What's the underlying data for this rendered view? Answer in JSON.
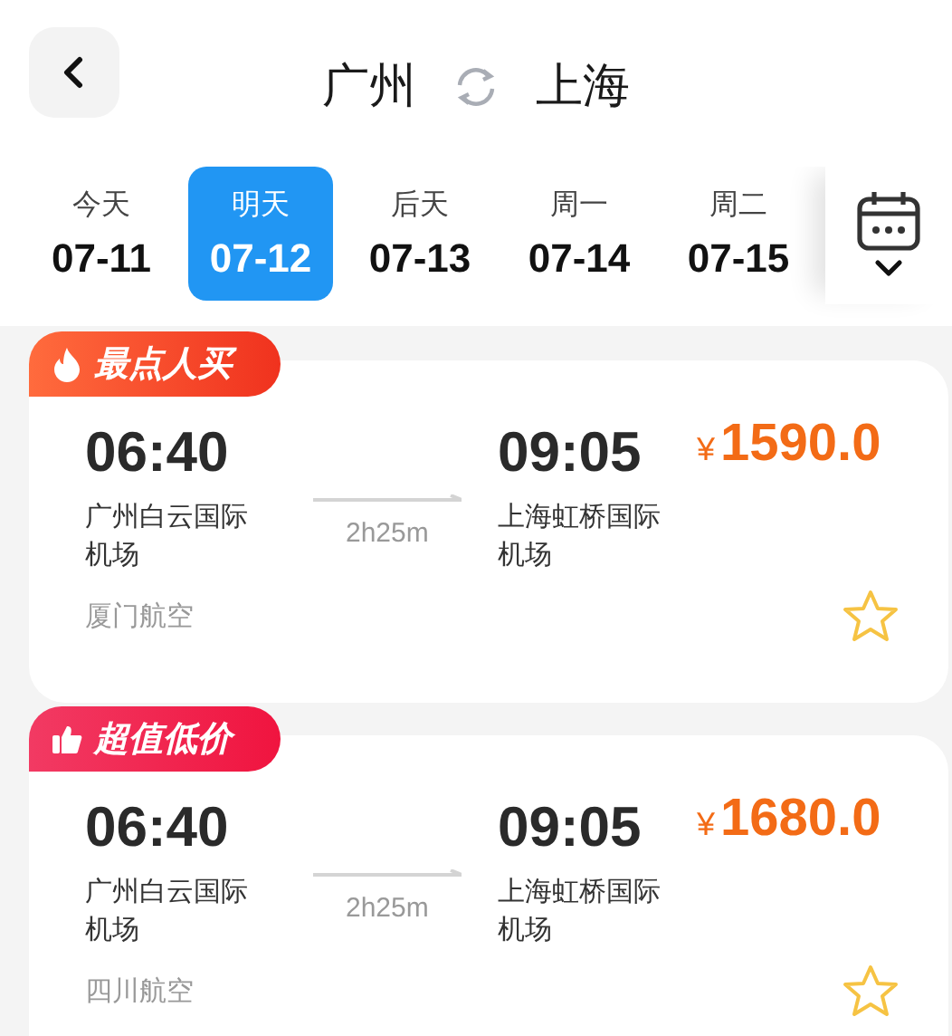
{
  "header": {
    "from": "广州",
    "to": "上海"
  },
  "dates": [
    {
      "day": "今天",
      "date": "07-11",
      "selected": false
    },
    {
      "day": "明天",
      "date": "07-12",
      "selected": true
    },
    {
      "day": "后天",
      "date": "07-13",
      "selected": false
    },
    {
      "day": "周一",
      "date": "07-14",
      "selected": false
    },
    {
      "day": "周二",
      "date": "07-15",
      "selected": false
    }
  ],
  "flights": [
    {
      "badge": {
        "kind": "fire",
        "label": "最点人买"
      },
      "depart_time": "06:40",
      "depart_airport": "广州白云国际机场",
      "duration": "2h25m",
      "arrive_time": "09:05",
      "arrive_airport": "上海虹桥国际机场",
      "currency": "¥",
      "price": "1590.0",
      "airline": "厦门航空",
      "favorited": false
    },
    {
      "badge": {
        "kind": "thumb",
        "label": "超值低价"
      },
      "depart_time": "06:40",
      "depart_airport": "广州白云国际机场",
      "duration": "2h25m",
      "arrive_time": "09:05",
      "arrive_airport": "上海虹桥国际机场",
      "currency": "¥",
      "price": "1680.0",
      "airline": "四川航空",
      "favorited": false
    }
  ]
}
